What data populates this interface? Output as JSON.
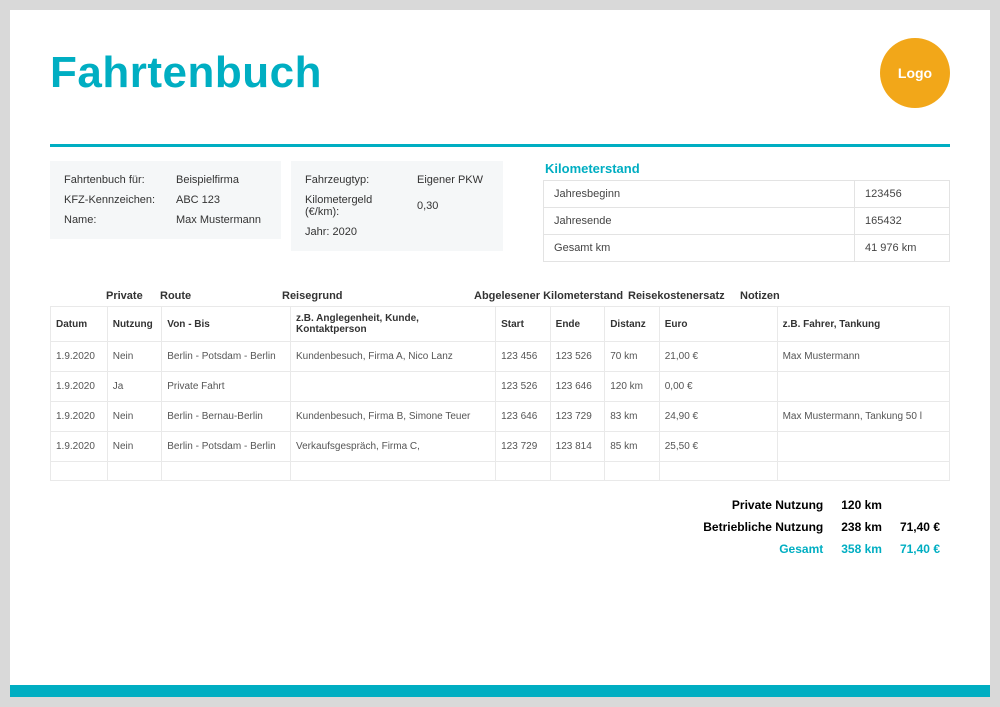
{
  "title": "Fahrtenbuch",
  "logo_text": "Logo",
  "info1": {
    "fuer_label": "Fahrtenbuch für:",
    "fuer": "Beispielfirma",
    "kennz_label": "KFZ-Kennzeichen:",
    "kennz": "ABC 123",
    "name_label": "Name:",
    "name": "Max Mustermann"
  },
  "info2": {
    "typ_label": "Fahrzeugtyp:",
    "typ": "Eigener PKW",
    "kmgeld_label": "Kilometergeld (€/km):",
    "kmgeld": "0,30",
    "jahr_label": "Jahr: 2020"
  },
  "km": {
    "heading": "Kilometerstand",
    "beginn_l": "Jahresbeginn",
    "beginn_v": "123456",
    "ende_l": "Jahresende",
    "ende_v": "165432",
    "ges_l": "Gesamt km",
    "ges_v": "41 976 km"
  },
  "groups": {
    "private": "Private",
    "route": "Route",
    "grund": "Reisegrund",
    "abg": "Abgelesener Kilometerstand",
    "ersatz": "Reisekostenersatz",
    "notizen": "Notizen"
  },
  "cols": {
    "datum": "Datum",
    "nutz": "Nutzung",
    "vonbis": "Von - Bis",
    "grund": "z.B. Anglegenheit, Kunde, Kontaktperson",
    "start": "Start",
    "ende": "Ende",
    "distanz": "Distanz",
    "euro": "Euro",
    "notiz": "z.B. Fahrer, Tankung"
  },
  "rows": [
    {
      "datum": "1.9.2020",
      "nutz": "Nein",
      "route": "Berlin - Potsdam - Berlin",
      "grund": "Kundenbesuch, Firma A, Nico Lanz",
      "start": "123 456",
      "ende": "123 526",
      "dist": "70 km",
      "euro": "21,00 €",
      "notiz": "Max Mustermann"
    },
    {
      "datum": "1.9.2020",
      "nutz": "Ja",
      "route": "Private Fahrt",
      "grund": "",
      "start": "123 526",
      "ende": "123 646",
      "dist": "120 km",
      "euro": "0,00 €",
      "notiz": ""
    },
    {
      "datum": "1.9.2020",
      "nutz": "Nein",
      "route": "Berlin - Bernau-Berlin",
      "grund": "Kundenbesuch, Firma B, Simone Teuer",
      "start": "123 646",
      "ende": "123 729",
      "dist": "83 km",
      "euro": "24,90 €",
      "notiz": "Max Mustermann, Tankung 50 l"
    },
    {
      "datum": "1.9.2020",
      "nutz": "Nein",
      "route": "Berlin - Potsdam - Berlin",
      "grund": "Verkaufsgespräch, Firma C,",
      "start": "123 729",
      "ende": "123 814",
      "dist": "85 km",
      "euro": "25,50 €",
      "notiz": ""
    },
    {
      "datum": "",
      "nutz": "",
      "route": "",
      "grund": "",
      "start": "",
      "ende": "",
      "dist": "",
      "euro": "",
      "notiz": ""
    }
  ],
  "summary": {
    "priv_l": "Private Nutzung",
    "priv_km": "120 km",
    "priv_eur": "",
    "betr_l": "Betriebliche Nutzung",
    "betr_km": "238 km",
    "betr_eur": "71,40 €",
    "ges_l": "Gesamt",
    "ges_km": "358 km",
    "ges_eur": "71,40 €"
  }
}
